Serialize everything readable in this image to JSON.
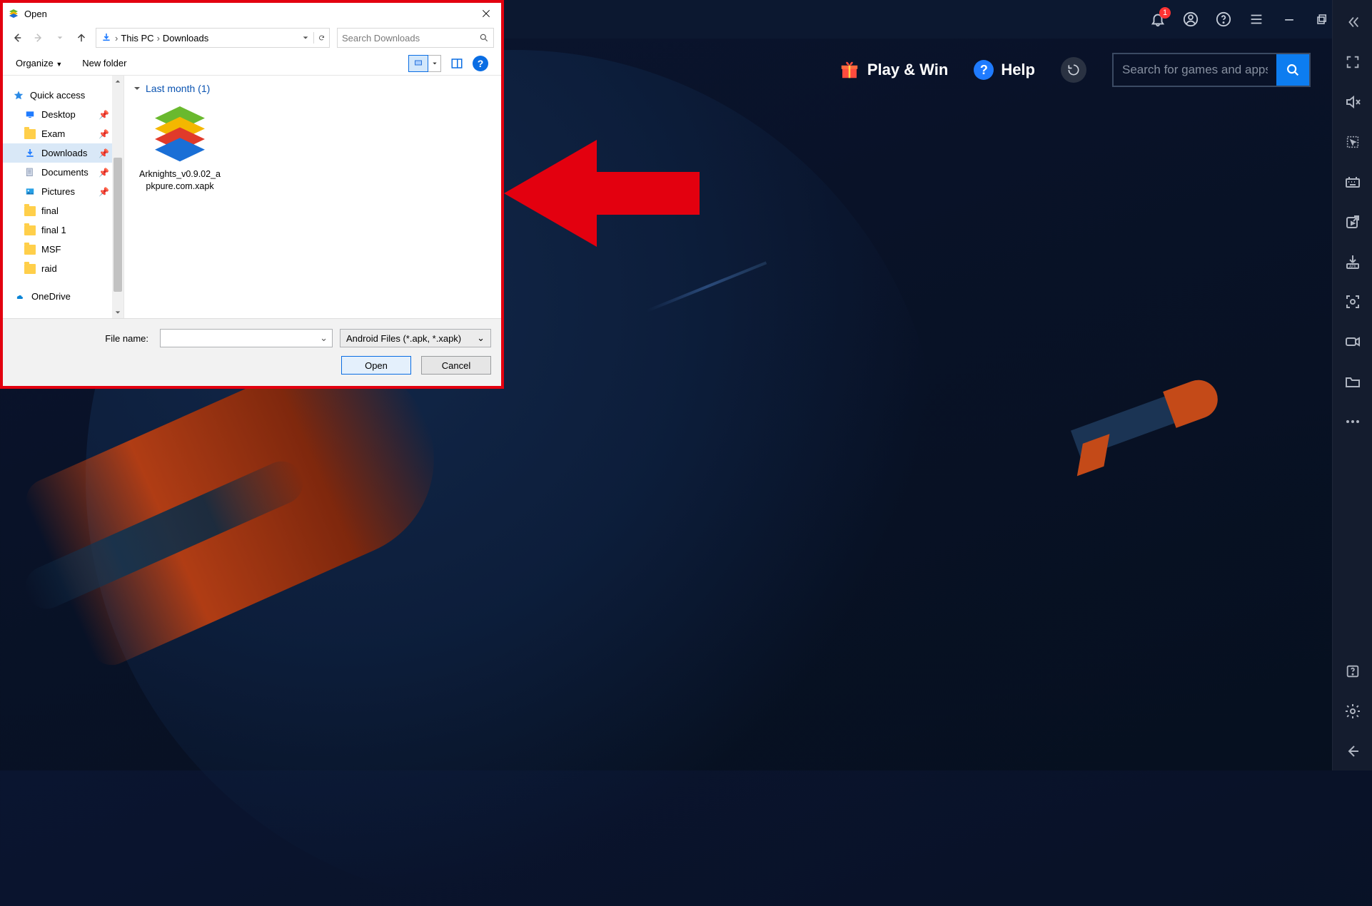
{
  "colors": {
    "accent": "#0d7df0",
    "danger": "#e3000f",
    "headerBg": "#0c1830"
  },
  "header": {
    "notifBadge": "1"
  },
  "navbar": {
    "playwin": "Play & Win",
    "help": "Help",
    "searchPlaceholder": "Search for games and apps"
  },
  "dialog": {
    "title": "Open",
    "breadcrumb": {
      "root": "This PC",
      "current": "Downloads"
    },
    "searchPlaceholder": "Search Downloads",
    "toolbar": {
      "organize": "Organize",
      "newFolder": "New folder"
    },
    "tree": {
      "quickAccess": "Quick access",
      "items": [
        {
          "label": "Desktop",
          "pinned": true
        },
        {
          "label": "Exam",
          "pinned": true
        },
        {
          "label": "Downloads",
          "pinned": true,
          "selected": true
        },
        {
          "label": "Documents",
          "pinned": true
        },
        {
          "label": "Pictures",
          "pinned": true
        },
        {
          "label": "final",
          "pinned": false
        },
        {
          "label": "final 1",
          "pinned": false
        },
        {
          "label": "MSF",
          "pinned": false
        },
        {
          "label": "raid",
          "pinned": false
        }
      ],
      "oneDrive": "OneDrive"
    },
    "group": {
      "header": "Last month (1)"
    },
    "file": {
      "name": "Arknights_v0.9.02_apkpure.com.xapk"
    },
    "footer": {
      "fileNameLabel": "File name:",
      "fileNameValue": "",
      "filter": "Android Files (*.apk, *.xapk)",
      "open": "Open",
      "cancel": "Cancel"
    }
  }
}
